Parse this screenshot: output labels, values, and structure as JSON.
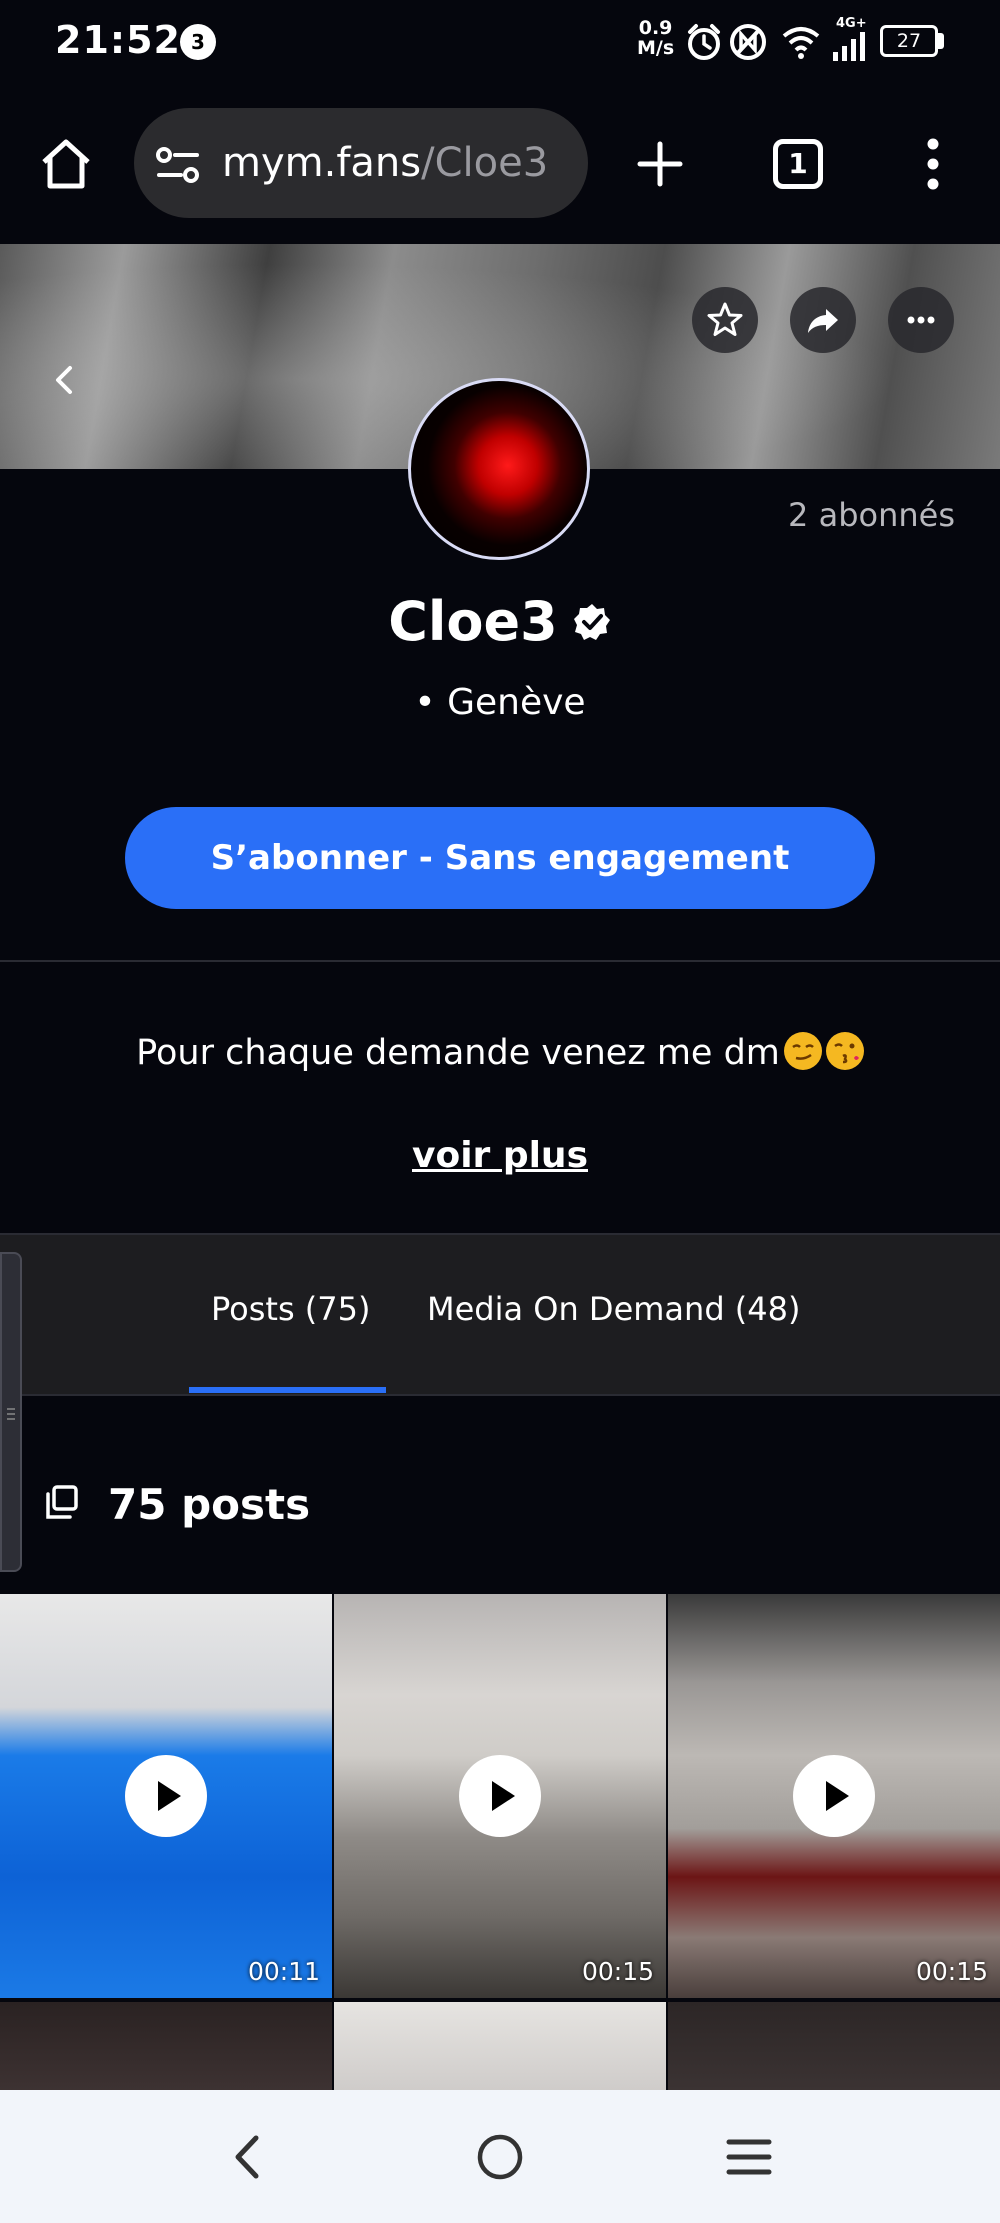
{
  "status_bar": {
    "time": "21:52",
    "notification_count": "3",
    "net_speed_value": "0.9",
    "net_speed_unit": "M/s",
    "network_type": "4G+",
    "battery": "27"
  },
  "browser": {
    "url_domain": "mym.fans",
    "url_path": "/Cloe3",
    "tab_count": "1"
  },
  "profile": {
    "subscribers": "2 abonnés",
    "name": "Cloe3",
    "location": "• Genève",
    "subscribe_label": "S’abonner - Sans engagement",
    "bio": "Pour chaque demande venez me dm",
    "see_more": "voir plus"
  },
  "tabs": [
    {
      "label": "Posts (75)",
      "active": true
    },
    {
      "label": "Media On Demand (48)",
      "active": false
    }
  ],
  "posts_header": "75 posts",
  "posts": [
    {
      "duration": "00:11"
    },
    {
      "duration": "00:15"
    },
    {
      "duration": "00:15"
    }
  ],
  "colors": {
    "accent": "#2a6ff7",
    "background": "#05060d",
    "tab_bar": "#1d1d20"
  },
  "icons": [
    "home-icon",
    "site-settings-icon",
    "new-tab-icon",
    "more-icon",
    "star-icon",
    "share-icon",
    "ellipsis-icon",
    "back-chevron-icon",
    "verified-icon",
    "posts-icon",
    "play-icon",
    "nav-back-icon",
    "nav-home-icon",
    "nav-menu-icon"
  ]
}
